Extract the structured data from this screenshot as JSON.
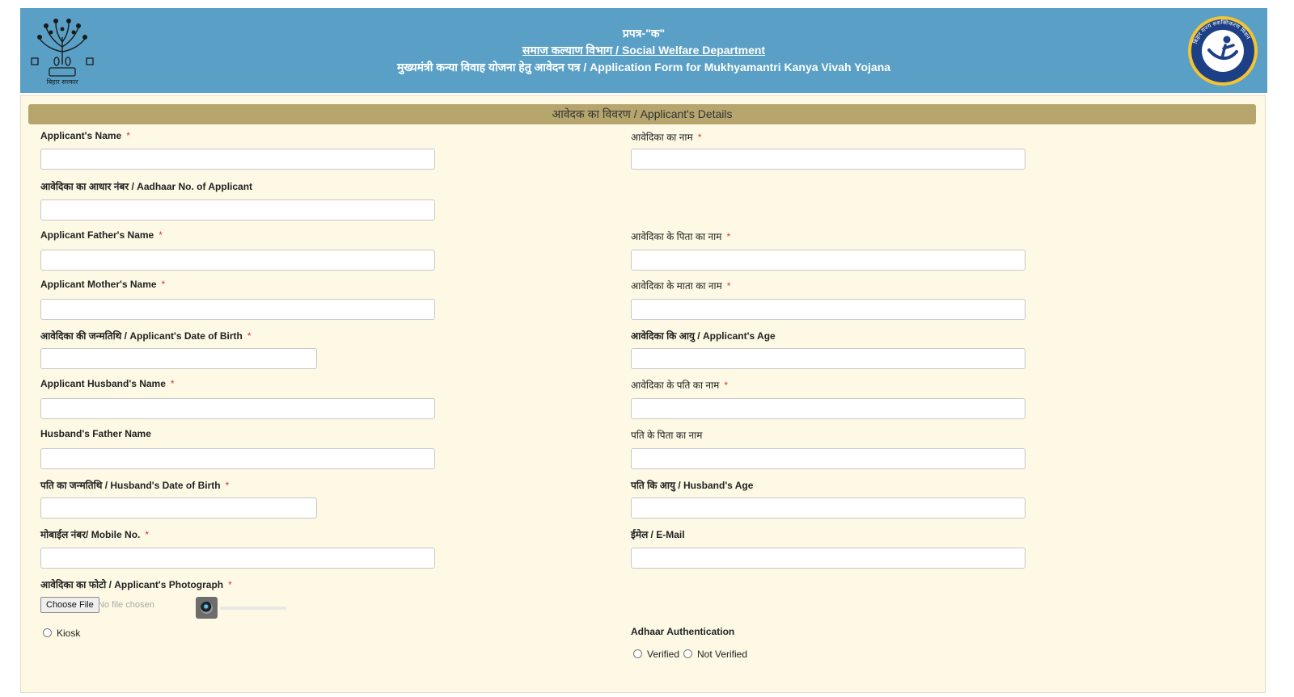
{
  "header": {
    "logo_left_caption": "बिहार सरकार",
    "logo_right_caption": "बिहार राज्य सशक्तिकरण मिशन",
    "line1": "प्रपत्र-\"क\"",
    "line2": "समाज कल्याण विभाग / Social Welfare Department",
    "line3": "मुख्यमंत्री कन्या विवाह योजना हेतु आवेदन पत्र / Application Form for Mukhyamantri Kanya Vivah Yojana"
  },
  "section": {
    "title": "आवेदक का विवरण / Applicant's Details"
  },
  "form": {
    "required_mark": "*",
    "fields": {
      "applicant_name": {
        "label": "Applicant's Name",
        "value": ""
      },
      "applicant_name_hi": {
        "label": "आवेदिका का नाम",
        "value": ""
      },
      "aadhaar": {
        "label": "आवेदिका का आधार नंबर / Aadhaar No. of Applicant",
        "value": ""
      },
      "father_name": {
        "label": "Applicant Father's Name",
        "value": ""
      },
      "father_name_hi": {
        "label": "आवेदिका के पिता का नाम",
        "value": ""
      },
      "mother_name": {
        "label": "Applicant Mother's Name",
        "value": ""
      },
      "mother_name_hi": {
        "label": "आवेदिका के माता का नाम",
        "value": ""
      },
      "dob": {
        "label": "आवेदिका की जन्मतिथि / Applicant's Date of Birth",
        "value": ""
      },
      "age": {
        "label": "आवेदिका कि आयु / Applicant's Age",
        "value": ""
      },
      "husband_name": {
        "label": "Applicant Husband's Name",
        "value": ""
      },
      "husband_name_hi": {
        "label": "आवेदिका के पति का नाम",
        "value": ""
      },
      "husband_father": {
        "label": "Husband's Father Name",
        "value": ""
      },
      "husband_father_hi": {
        "label": "पति के पिता का नाम",
        "value": ""
      },
      "husband_dob": {
        "label": "पति का जन्मतिथि / Husband's Date of Birth",
        "value": ""
      },
      "husband_age": {
        "label": "पति कि आयु / Husband's Age",
        "value": ""
      },
      "mobile": {
        "label": "मोबाईल नंबर/ Mobile No.",
        "value": ""
      },
      "email": {
        "label": "ईमेल / E-Mail",
        "value": ""
      },
      "photo": {
        "label": "आवेदिका का फोटो / Applicant's Photograph"
      }
    },
    "file_button": "Choose File",
    "file_status": "No file chosen",
    "kiosk_label": "Kiosk",
    "adhaar_auth": {
      "title": "Adhaar Authentication",
      "options": [
        "Verified",
        "Not Verified"
      ]
    }
  }
}
